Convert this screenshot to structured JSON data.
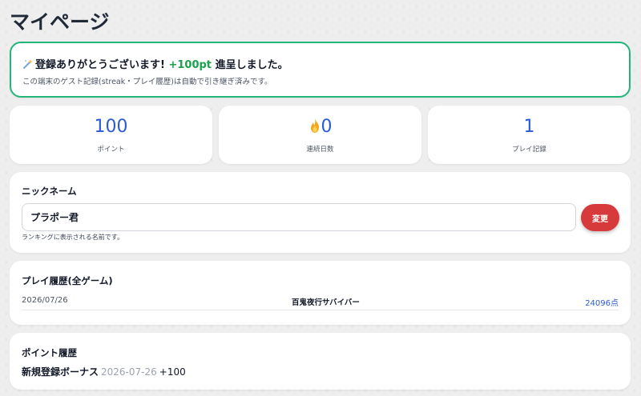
{
  "page": {
    "title": "マイページ"
  },
  "banner": {
    "prefix": "登録ありがとうございます!",
    "points": "+100pt",
    "suffix": "進呈しました。",
    "note": "この端末のゲスト記録(streak・プレイ履歴)は自動で引き継ぎ済みです。",
    "border_color": "#22b67a",
    "icon": "sparkle-icon"
  },
  "stats": [
    {
      "value": "100",
      "label": "ポイント"
    },
    {
      "value": "0",
      "label": "連続日数",
      "icon": "fire-icon"
    },
    {
      "value": "1",
      "label": "プレイ記録"
    }
  ],
  "nickname": {
    "title": "ニックネーム",
    "value": "プラポー君",
    "button_label": "変更",
    "hint": "ランキングに表示される名前です。",
    "button_color": "#d63a3a"
  },
  "play_history": {
    "title": "プレイ履歴(全ゲーム)",
    "rows": [
      {
        "date": "2026/07/26",
        "game": "百鬼夜行サバイバー",
        "score": "24096点"
      }
    ]
  },
  "point_history": {
    "title": "ポイント履歴",
    "entries": [
      {
        "name": "新規登録ボーナス",
        "date": "2026-07-26",
        "amount": "+100"
      }
    ]
  },
  "colors": {
    "accent": "#2d5bd3",
    "success": "#16a34a"
  }
}
